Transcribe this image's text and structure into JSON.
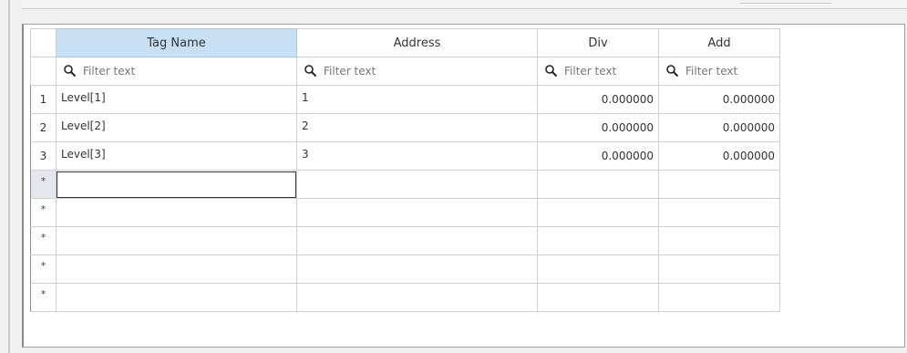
{
  "table": {
    "columns": [
      "Tag Name",
      "Address",
      "Div",
      "Add"
    ],
    "selected_column": "Tag Name",
    "filter_placeholder": "Filter text",
    "rows": [
      {
        "num": "1",
        "tag": "Level[1]",
        "address": "1",
        "div": "0.000000",
        "add": "0.000000"
      },
      {
        "num": "2",
        "tag": "Level[2]",
        "address": "2",
        "div": "0.000000",
        "add": "0.000000"
      },
      {
        "num": "3",
        "tag": "Level[3]",
        "address": "3",
        "div": "0.000000",
        "add": "0.000000"
      }
    ],
    "new_row_marker": "*",
    "empty_row_markers": [
      "*",
      "*",
      "*",
      "*",
      "*"
    ]
  },
  "icons": {
    "filter": "search-icon"
  },
  "colors": {
    "selected_header": "#c7e0f4",
    "grid_line": "#d0d0d0",
    "background": "#f0f0f0"
  }
}
